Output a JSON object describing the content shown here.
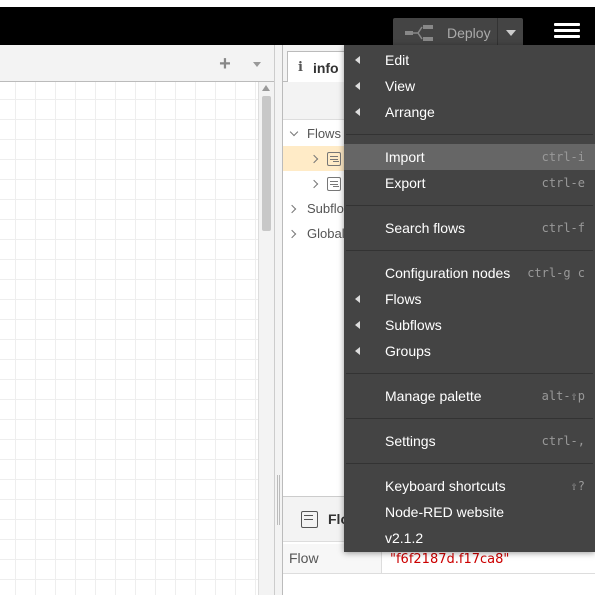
{
  "header": {
    "deploy_label": "Deploy"
  },
  "workspace": {
    "add_tab_label": "+"
  },
  "sidebar": {
    "info_tab_label": "info",
    "info_tab_icon": "i",
    "tree": [
      {
        "label": "Flows",
        "expanded": true
      },
      {
        "label": "",
        "selected": true
      },
      {
        "label": ""
      },
      {
        "label": "Subflows"
      },
      {
        "label": "Global"
      }
    ],
    "bottom_title": "Flo",
    "property": {
      "key": "Flow",
      "value": "\"f6f2187d.f17ca8\""
    }
  },
  "menu": {
    "items": [
      {
        "label": "Edit",
        "submenu": true
      },
      {
        "label": "View",
        "submenu": true
      },
      {
        "label": "Arrange",
        "submenu": true
      },
      {
        "label": "Import",
        "shortcut": "ctrl-i",
        "highlighted": true
      },
      {
        "label": "Export",
        "shortcut": "ctrl-e"
      },
      {
        "label": "Search flows",
        "shortcut": "ctrl-f"
      },
      {
        "label": "Configuration nodes",
        "shortcut": "ctrl-g c"
      },
      {
        "label": "Flows",
        "submenu": true
      },
      {
        "label": "Subflows",
        "submenu": true
      },
      {
        "label": "Groups",
        "submenu": true
      },
      {
        "label": "Manage palette",
        "shortcut": "alt-⇧p"
      },
      {
        "label": "Settings",
        "shortcut": "ctrl-,"
      },
      {
        "label": "Keyboard shortcuts",
        "shortcut": "⇧?"
      },
      {
        "label": "Node-RED website"
      },
      {
        "label": "v2.1.2"
      }
    ]
  }
}
